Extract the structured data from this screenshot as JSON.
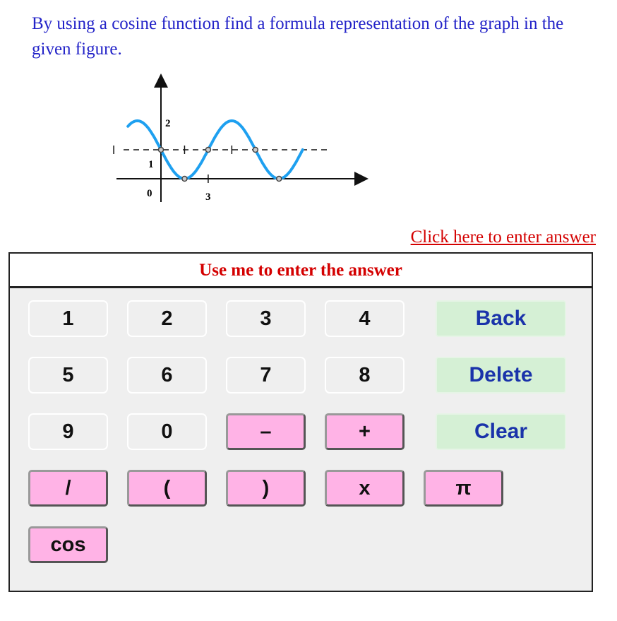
{
  "question": "By using a cosine function find a formula representation of the graph in the given figure.",
  "graph": {
    "labels": {
      "y2": "2",
      "y1": "1",
      "origin": "0",
      "x3": "3"
    },
    "curve_color": "#1ea0f0",
    "midline": 1,
    "amplitude": 1,
    "period": 6,
    "marked_points": [
      [
        0,
        1
      ],
      [
        1.5,
        0
      ],
      [
        3,
        1
      ],
      [
        6,
        1
      ],
      [
        7.5,
        0
      ]
    ]
  },
  "link": "Click here to enter answer",
  "keypad": {
    "title": "Use me to enter the answer",
    "keys": [
      {
        "l": "1",
        "t": "num",
        "c": 0,
        "r": 0
      },
      {
        "l": "2",
        "t": "num",
        "c": 1,
        "r": 0
      },
      {
        "l": "3",
        "t": "num",
        "c": 2,
        "r": 0
      },
      {
        "l": "4",
        "t": "num",
        "c": 3,
        "r": 0
      },
      {
        "l": "Back",
        "t": "grn",
        "c": 4,
        "r": 0
      },
      {
        "l": "5",
        "t": "num",
        "c": 0,
        "r": 1
      },
      {
        "l": "6",
        "t": "num",
        "c": 1,
        "r": 1
      },
      {
        "l": "7",
        "t": "num",
        "c": 2,
        "r": 1
      },
      {
        "l": "8",
        "t": "num",
        "c": 3,
        "r": 1
      },
      {
        "l": "Delete",
        "t": "grn",
        "c": 4,
        "r": 1
      },
      {
        "l": "9",
        "t": "num",
        "c": 0,
        "r": 2
      },
      {
        "l": "0",
        "t": "num",
        "c": 1,
        "r": 2
      },
      {
        "l": "–",
        "t": "pnk",
        "c": 2,
        "r": 2
      },
      {
        "l": "+",
        "t": "pnk",
        "c": 3,
        "r": 2
      },
      {
        "l": "Clear",
        "t": "grn",
        "c": 4,
        "r": 2
      },
      {
        "l": "/",
        "t": "pnk",
        "c": 0,
        "r": 3
      },
      {
        "l": "(",
        "t": "pnk",
        "c": 1,
        "r": 3
      },
      {
        "l": ")",
        "t": "pnk",
        "c": 2,
        "r": 3
      },
      {
        "l": "x",
        "t": "pnk",
        "c": 3,
        "r": 3
      },
      {
        "l": "π",
        "t": "pnk",
        "c": 5,
        "r": 3
      },
      {
        "l": "cos",
        "t": "pnk",
        "c": 0,
        "r": 4
      }
    ]
  }
}
